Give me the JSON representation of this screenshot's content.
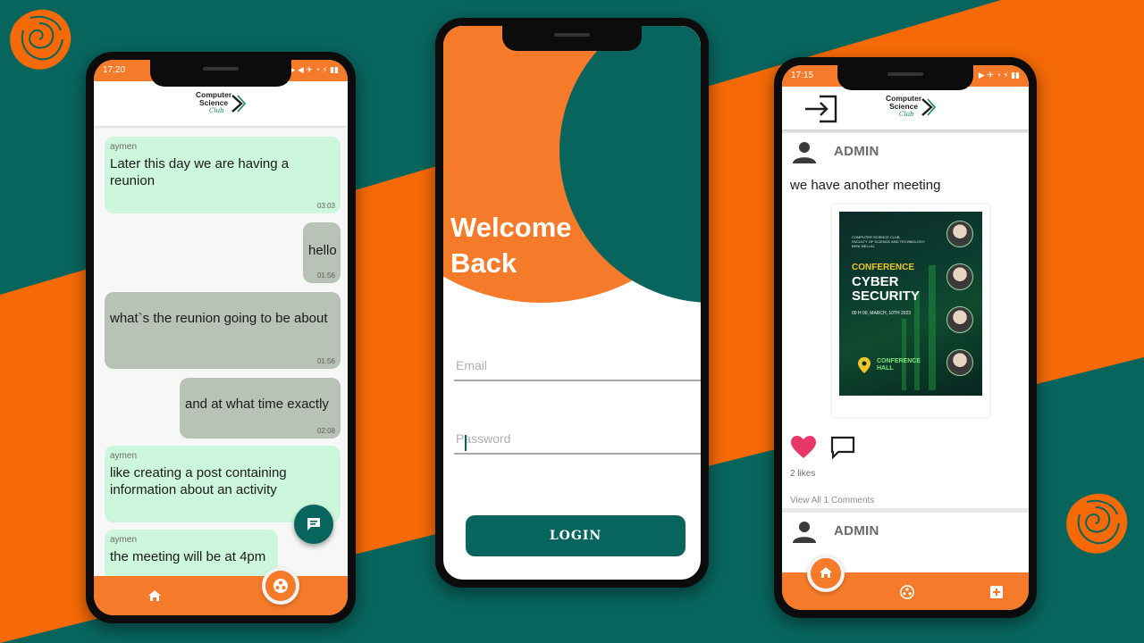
{
  "colors": {
    "orange": "#f57a2a",
    "teal": "#08655e",
    "bubble_in": "#cdf7dc",
    "bubble_out": "#b9c2b6",
    "heart": "#e8386a"
  },
  "logo": {
    "line1": "Computer",
    "line2": "Science",
    "line3": "Club"
  },
  "chat_screen": {
    "status_time": "17:20",
    "status_icons": "▶ ◀  ✈ ◔ ⚡ ▮▮",
    "messages": [
      {
        "sender": "aymen",
        "text": "Later this day we are having a reunion",
        "time": "03:03",
        "direction": "in"
      },
      {
        "sender": "",
        "text": "hello",
        "time": "01:56",
        "direction": "out"
      },
      {
        "sender": "",
        "text": "what`s the reunion going to be about",
        "time": "01:56",
        "direction": "out"
      },
      {
        "sender": "",
        "text": "and at what time exactly",
        "time": "02:08",
        "direction": "out"
      },
      {
        "sender": "aymen",
        "text": "like creating a post containing information about an activity",
        "time": "",
        "direction": "in"
      },
      {
        "sender": "aymen",
        "text": "the meeting will be at 4pm",
        "time": "",
        "direction": "in"
      }
    ],
    "fab_icon": "message-icon",
    "nav": {
      "home_icon": "home-icon",
      "center_icon": "club-icon"
    }
  },
  "login_screen": {
    "welcome_line1": "Welcome",
    "welcome_line2": "Back",
    "email_placeholder": "Email",
    "password_placeholder": "Password",
    "login_label": "LOGIN"
  },
  "feed_screen": {
    "status_time": "17:15",
    "status_icons": "▶ ✈ ◔ ⚡ ▮▮",
    "logout_icon": "logout-icon",
    "posts": [
      {
        "author": "ADMIN",
        "text": "we have another meeting",
        "poster": {
          "header": "COMPUTER SCIENCE CLUB",
          "header2": "FACULTY OF SCIENCE AND TECHNOLOGY, BENI MELLAL",
          "kicker": "CONFERENCE",
          "title1": "CYBER",
          "title2": "SECURITY",
          "date": "09 H 00, MARCH, 10TH 2023",
          "hall1": "CONFERENCE",
          "hall2": "HALL"
        },
        "likes": "2 likes",
        "comments": "View All 1 Comments"
      },
      {
        "author": "ADMIN"
      }
    ],
    "nav": {
      "home_icon": "home-icon",
      "club_icon": "club-icon",
      "add_icon": "add-icon"
    }
  }
}
